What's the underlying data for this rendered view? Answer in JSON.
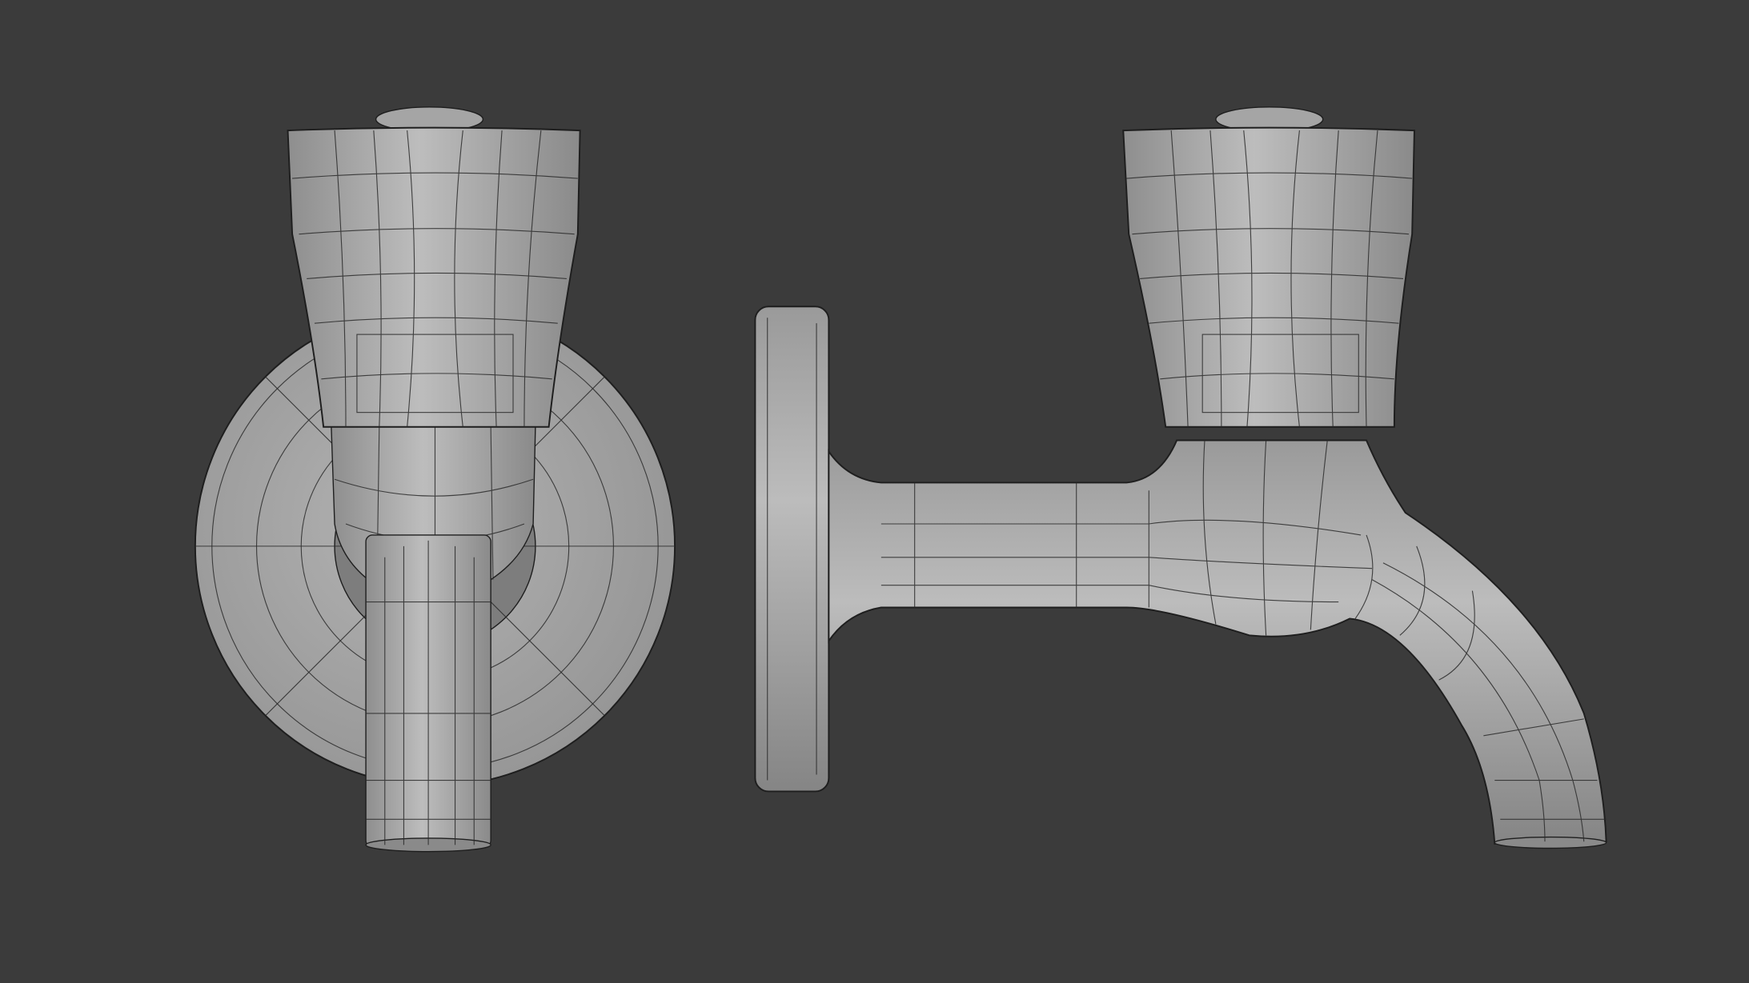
{
  "scene": {
    "views": [
      "front",
      "side"
    ],
    "colors": {
      "background": "#3b3b3b",
      "model": "#a9a9a9",
      "wireframe": "#2a2a2a"
    }
  }
}
